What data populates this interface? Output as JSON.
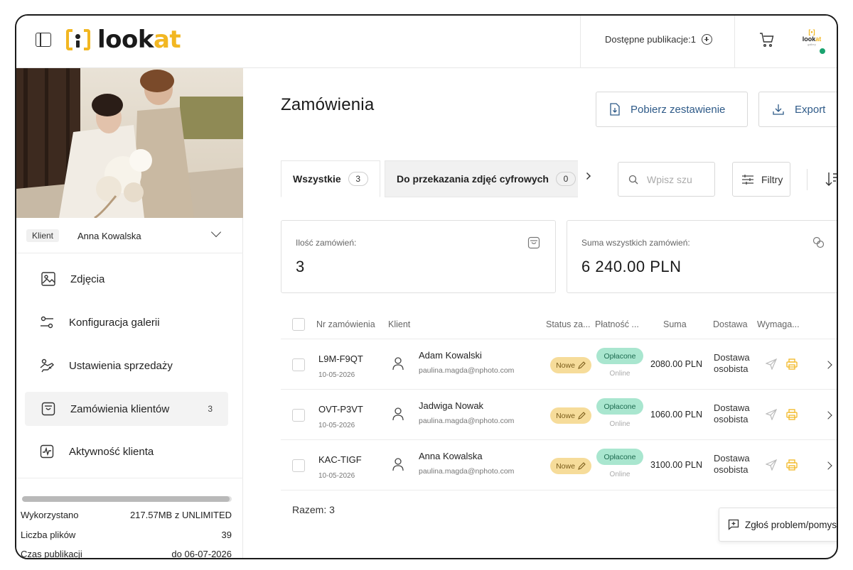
{
  "app": {
    "logo_text_1": "look",
    "logo_text_2": "at",
    "mini_logo_text_1": "look",
    "mini_logo_text_2": "at",
    "mini_logo_sub": "gallery"
  },
  "header": {
    "available_publications": "Dostępne publikacje:1"
  },
  "sidebar": {
    "client_tag": "Klient",
    "client_name": "Anna Kowalska",
    "items": [
      {
        "label": "Zdjęcia",
        "icon": "image-icon"
      },
      {
        "label": "Konfiguracja galerii",
        "icon": "settings-sliders-icon"
      },
      {
        "label": "Ustawienia sprzedaży",
        "icon": "hand-coin-icon"
      },
      {
        "label": "Zamówienia klientów",
        "icon": "shopping-bag-icon",
        "count": "3",
        "active": true
      },
      {
        "label": "Aktywność klienta",
        "icon": "activity-icon"
      }
    ],
    "storage_used_fraction": 0.99,
    "stats": [
      {
        "label": "Wykorzystano",
        "value": "217.57MB z UNLIMITED"
      },
      {
        "label": "Liczba plików",
        "value": "39"
      },
      {
        "label": "Czas publikacji",
        "value": "do 06-07-2026"
      }
    ]
  },
  "main": {
    "title": "Zamówienia",
    "buttons": {
      "download_summary": "Pobierz zestawienie",
      "export": "Export"
    },
    "tabs": [
      {
        "label": "Wszystkie",
        "count": "3",
        "active": true
      },
      {
        "label": "Do przekazania zdjęć cyfrowych",
        "count": "0"
      }
    ],
    "search": {
      "placeholder": "Wpisz szu"
    },
    "filters_label": "Filtry",
    "cards": {
      "orders_label": "Ilość zamówień:",
      "orders_value": "3",
      "sum_label": "Suma wszystkich zamówień:",
      "sum_value": "6 240.00 PLN"
    },
    "table": {
      "headers": {
        "order_no": "Nr zamówienia",
        "client": "Klient",
        "status": "Status za...",
        "payment": "Płatność ...",
        "sum": "Suma",
        "delivery": "Dostawa",
        "required": "Wymaga..."
      },
      "rows": [
        {
          "id": "L9M-F9QT",
          "date": "10-05-2026",
          "client": "Adam Kowalski",
          "email": "paulina.magda@nphoto.com",
          "status": "Nowe",
          "payment": "Opłacone",
          "payment_method": "Online",
          "sum": "2080.00 PLN",
          "delivery_1": "Dostawa",
          "delivery_2": "osobista"
        },
        {
          "id": "OVT-P3VT",
          "date": "10-05-2026",
          "client": "Jadwiga Nowak",
          "email": "paulina.magda@nphoto.com",
          "status": "Nowe",
          "payment": "Opłacone",
          "payment_method": "Online",
          "sum": "1060.00 PLN",
          "delivery_1": "Dostawa",
          "delivery_2": "osobista"
        },
        {
          "id": "KAC-TIGF",
          "date": "10-05-2026",
          "client": "Anna Kowalska",
          "email": "paulina.magda@nphoto.com",
          "status": "Nowe",
          "payment": "Opłacone",
          "payment_method": "Online",
          "sum": "3100.00 PLN",
          "delivery_1": "Dostawa",
          "delivery_2": "osobista"
        }
      ],
      "total": "Razem: 3"
    },
    "report_problem": "Zgłoś problem/pomysł"
  },
  "colors": {
    "accent": "#f2b722",
    "new_badge": "#f6dc9a",
    "paid_badge": "#a9e6cf",
    "link": "#2e5a88",
    "online": "#1aa36f"
  }
}
